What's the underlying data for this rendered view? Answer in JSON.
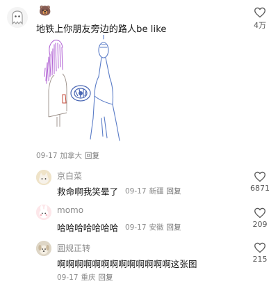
{
  "post": {
    "username_emoji": "🐻",
    "text": "地铁上你朋友旁边的路人be like",
    "date": "09-17",
    "location": "加拿大",
    "reply_label": "回复",
    "like_count": "4万"
  },
  "replies": [
    {
      "username": "京白菜",
      "text": "救命啊我笑晕了",
      "date": "09-17",
      "location": "新疆",
      "reply_label": "回复",
      "like_count": "6871"
    },
    {
      "username": "momo",
      "text": "哈哈哈哈哈哈哈",
      "date": "09-17",
      "location": "安徽",
      "reply_label": "回复",
      "like_count": "209"
    },
    {
      "username": "圆规正转",
      "text": "啊啊啊啊啊啊啊啊啊啊啊啊啊这张图",
      "date": "09-17",
      "location": "重庆",
      "reply_label": "回复",
      "like_count": "215"
    }
  ]
}
